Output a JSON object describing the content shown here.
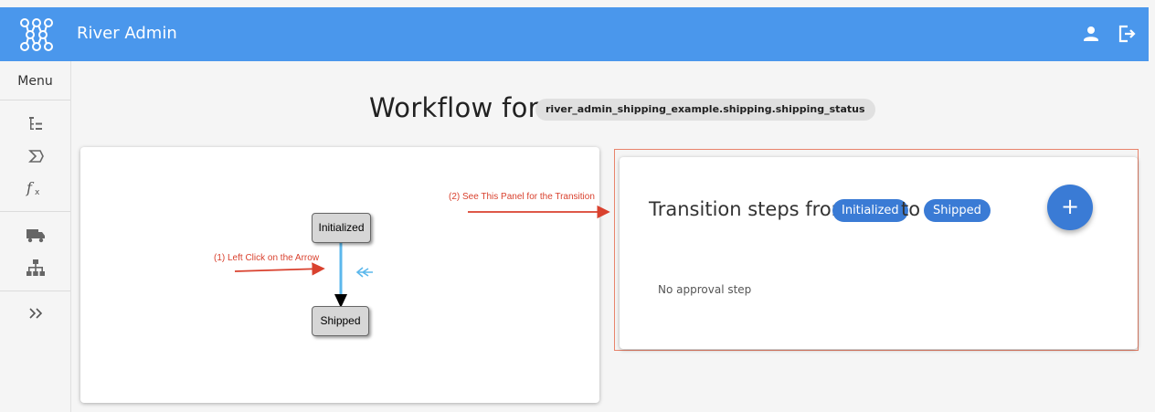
{
  "header": {
    "app_title": "River Admin",
    "logo_icon": "network-logo-icon",
    "icons": [
      "user-icon",
      "logout-icon"
    ],
    "color": "#4a97ec"
  },
  "sidebar": {
    "menu_label": "Menu",
    "icons": [
      "hierarchy-list-icon",
      "summation-icon",
      "function-icon",
      "truck-icon",
      "org-chart-icon",
      "expand-chevrons-icon"
    ]
  },
  "main": {
    "title": "Workflow for",
    "workflow_name": "river_admin_shipping_example.shipping.shipping_status"
  },
  "diagram": {
    "nodes": {
      "source": "Initialized",
      "destination": "Shipped"
    },
    "annotation_1": "(1) Left Click on the Arrow",
    "annotation_2": "(2) See This Panel for the Transition"
  },
  "panel": {
    "heading_prefix": "Transition steps from",
    "source_state": "Initialized",
    "connector": "to",
    "destination_state": "Shipped",
    "add_button_label": "+",
    "empty_text": "No approval step",
    "accent": "#3a7bd5"
  }
}
